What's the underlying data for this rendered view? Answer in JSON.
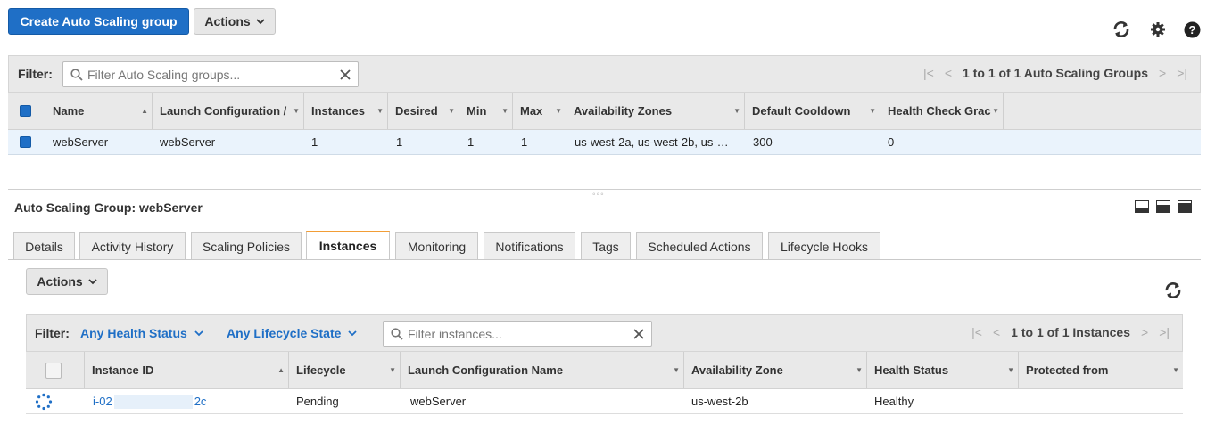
{
  "toolbar": {
    "create_label": "Create Auto Scaling group",
    "actions_label": "Actions"
  },
  "groups_filter": {
    "label": "Filter:",
    "placeholder": "Filter Auto Scaling groups...",
    "pager_text": "1 to 1 of 1 Auto Scaling Groups"
  },
  "groups_table": {
    "columns": [
      "Name",
      "Launch Configuration /",
      "Instances",
      "Desired",
      "Min",
      "Max",
      "Availability Zones",
      "Default Cooldown",
      "Health Check Grac"
    ],
    "rows": [
      [
        "webServer",
        "webServer",
        "1",
        "1",
        "1",
        "1",
        "us-west-2a, us-west-2b, us-…",
        "300",
        "0"
      ]
    ]
  },
  "details": {
    "title": "Auto Scaling Group: webServer",
    "tabs": [
      "Details",
      "Activity History",
      "Scaling Policies",
      "Instances",
      "Monitoring",
      "Notifications",
      "Tags",
      "Scheduled Actions",
      "Lifecycle Hooks"
    ],
    "active_tab": "Instances",
    "actions_label": "Actions"
  },
  "instances_filter": {
    "label": "Filter:",
    "health_dropdown": "Any Health Status",
    "lifecycle_dropdown": "Any Lifecycle State",
    "placeholder": "Filter instances...",
    "pager_text": "1 to 1 of 1 Instances"
  },
  "instances_table": {
    "columns": [
      "Instance ID",
      "Lifecycle",
      "Launch Configuration Name",
      "Availability Zone",
      "Health Status",
      "Protected from"
    ],
    "rows": [
      {
        "id_prefix": "i-02",
        "id_suffix": "2c",
        "lifecycle": "Pending",
        "launch_config": "webServer",
        "zone": "us-west-2b",
        "health": "Healthy"
      }
    ]
  },
  "colors": {
    "primary": "#1f6fc6",
    "tab_accent": "#f29d36",
    "selected_row": "#eaf3fc"
  }
}
